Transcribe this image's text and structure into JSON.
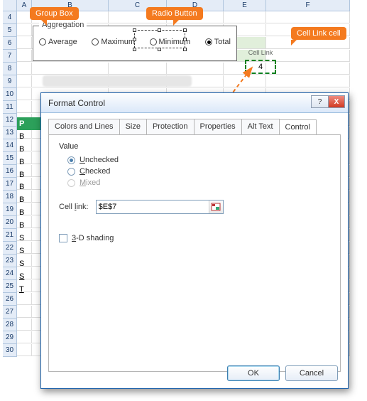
{
  "sheet": {
    "columns": [
      "A",
      "B",
      "C",
      "D",
      "E",
      "F"
    ],
    "row_start": 4,
    "row_end": 30,
    "header_cell": "P",
    "edge_values": [
      "B",
      "B",
      "B",
      "B",
      "B",
      "B",
      "B",
      "B",
      "S",
      "S",
      "S",
      "S",
      "T"
    ]
  },
  "groupbox": {
    "title": "Aggregation",
    "options": [
      "Average",
      "Maximum",
      "Minimum",
      "Total"
    ],
    "selected_index": 3
  },
  "cell_link": {
    "small_label": "Cell Link",
    "value": "4"
  },
  "callouts": {
    "groupbox": "Group Box",
    "radiobutton": "Radio Button",
    "celllink": "Cell Link cell"
  },
  "dialog": {
    "title": "Format Control",
    "tabs": [
      "Colors and Lines",
      "Size",
      "Protection",
      "Properties",
      "Alt Text",
      "Control"
    ],
    "active_tab": 5,
    "value_label": "Value",
    "value_options": {
      "unchecked": "Unchecked",
      "checked": "Checked",
      "mixed": "Mixed"
    },
    "value_selected": "unchecked",
    "cell_link_label": "Cell link:",
    "cell_link_value": "$E$7",
    "shade_label": "3-D shading",
    "ok": "OK",
    "cancel": "Cancel"
  }
}
